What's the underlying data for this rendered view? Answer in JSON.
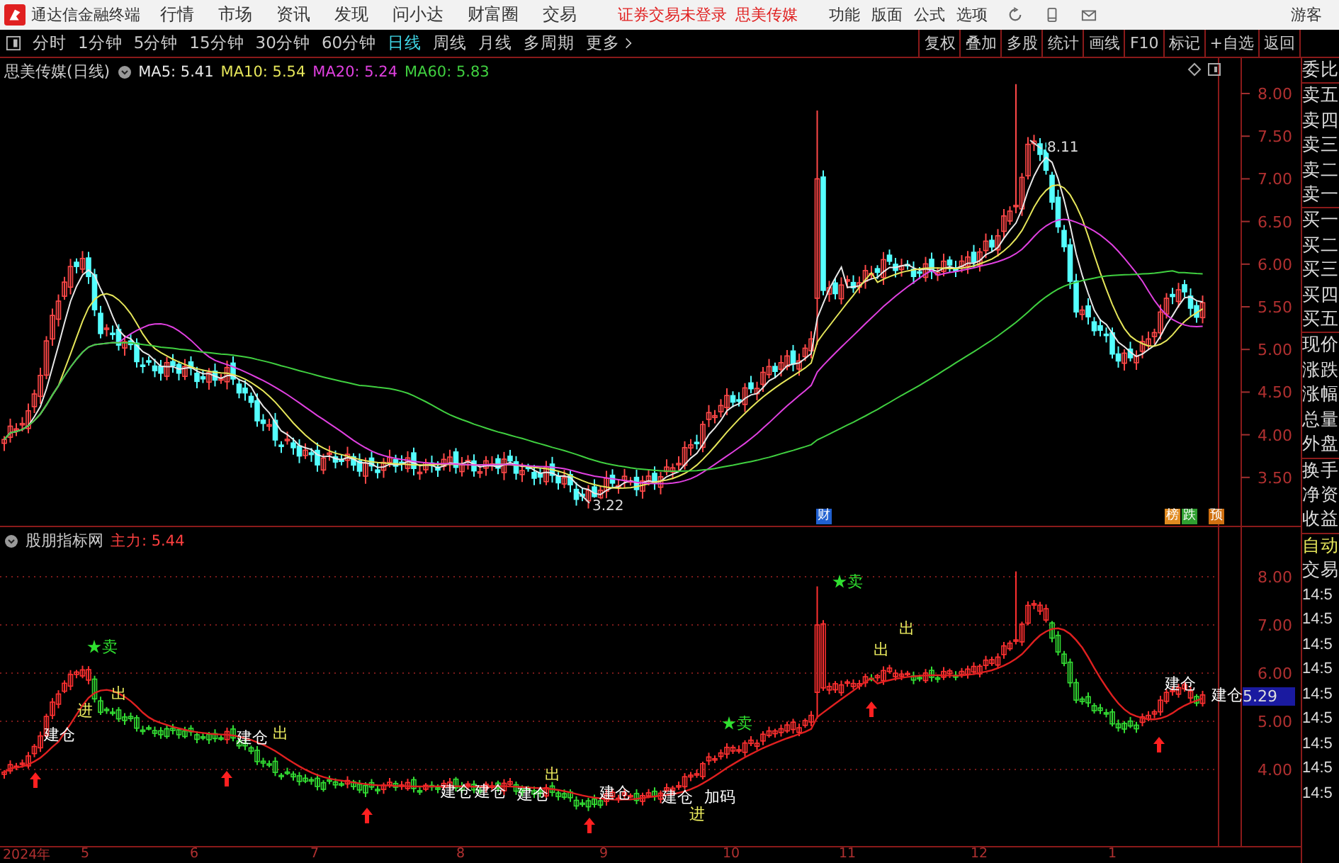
{
  "app": {
    "title": "通达信金融终端",
    "menu": [
      "行情",
      "市场",
      "资讯",
      "发现",
      "问小达",
      "财富圈",
      "交易"
    ],
    "notice": "证券交易未登录",
    "stock_link": "思美传媒",
    "tools": [
      "功能",
      "版面",
      "公式",
      "选项"
    ],
    "user": "游客"
  },
  "periods": [
    {
      "label": "分时",
      "selected": false
    },
    {
      "label": "1分钟",
      "selected": false
    },
    {
      "label": "5分钟",
      "selected": false
    },
    {
      "label": "15分钟",
      "selected": false
    },
    {
      "label": "30分钟",
      "selected": false
    },
    {
      "label": "60分钟",
      "selected": false
    },
    {
      "label": "日线",
      "selected": true
    },
    {
      "label": "周线",
      "selected": false
    },
    {
      "label": "月线",
      "selected": false
    },
    {
      "label": "多周期",
      "selected": false
    },
    {
      "label": "更多",
      "selected": false
    }
  ],
  "actions": [
    "复权",
    "叠加",
    "多股",
    "统计",
    "画线",
    "F10",
    "标记",
    "+自选",
    "返回"
  ],
  "main_chart": {
    "title": "思美传媒(日线)",
    "indicators": [
      {
        "label": "MA5: 5.41",
        "color": "#e8e8e8"
      },
      {
        "label": "MA10: 5.54",
        "color": "#e6e65a"
      },
      {
        "label": "MA20: 5.24",
        "color": "#e040e0"
      },
      {
        "label": "MA60: 5.83",
        "color": "#40d040"
      }
    ],
    "y_ticks": [
      "8.00",
      "7.50",
      "7.00",
      "6.50",
      "6.00",
      "5.50",
      "5.00",
      "4.50",
      "4.00",
      "3.50"
    ],
    "high_label": "8.11",
    "low_label": "3.22",
    "badges": [
      {
        "text": "财",
        "color": "#2060d0"
      },
      {
        "text": "榜",
        "color": "#e08a20"
      },
      {
        "text": "跌",
        "color": "#30a030"
      },
      {
        "text": "预",
        "color": "#d07010"
      }
    ]
  },
  "sub_chart": {
    "title": "股朋指标网",
    "value": "主力: 5.44",
    "y_ticks": [
      "8.00",
      "7.00",
      "6.00",
      "5.00",
      "4.00"
    ],
    "price_tag": "5.29",
    "signals": [
      {
        "kind": "build",
        "text": "建仓"
      },
      {
        "kind": "sell",
        "text": "★卖"
      },
      {
        "kind": "in",
        "text": "进"
      },
      {
        "kind": "out",
        "text": "出"
      },
      {
        "kind": "build",
        "text": "建仓"
      },
      {
        "kind": "out",
        "text": "出"
      },
      {
        "kind": "build",
        "text": "建仓"
      },
      {
        "kind": "build",
        "text": "建仓"
      },
      {
        "kind": "build",
        "text": "建仓"
      },
      {
        "kind": "out",
        "text": "出"
      },
      {
        "kind": "build",
        "text": "建仓"
      },
      {
        "kind": "build",
        "text": "建仓"
      },
      {
        "kind": "in",
        "text": "进"
      },
      {
        "kind": "add",
        "text": "加码"
      },
      {
        "kind": "sell",
        "text": "★卖"
      },
      {
        "kind": "sell",
        "text": "★卖"
      },
      {
        "kind": "out",
        "text": "出"
      },
      {
        "kind": "out",
        "text": "出"
      },
      {
        "kind": "build",
        "text": "建仓"
      },
      {
        "kind": "build",
        "text": "建仓"
      }
    ]
  },
  "x_axis": [
    "2024年",
    "5",
    "6",
    "7",
    "8",
    "9",
    "10",
    "11",
    "12",
    "1"
  ],
  "quote_panel": {
    "groups": [
      [
        "委比"
      ],
      [
        "卖五",
        "卖四",
        "卖三",
        "卖二",
        "卖一"
      ],
      [
        "买一",
        "买二",
        "买三",
        "买四",
        "买五"
      ],
      [
        "现价",
        "涨跌",
        "涨幅",
        "总量",
        "外盘"
      ],
      [
        "换手",
        "净资",
        "收益"
      ]
    ]
  },
  "trade_panel": {
    "mode": "自动",
    "title": "交易",
    "times": [
      "14:5",
      "14:5",
      "14:5",
      "14:5",
      "14:5",
      "14:5",
      "14:5",
      "14:5",
      "14:5"
    ]
  }
}
